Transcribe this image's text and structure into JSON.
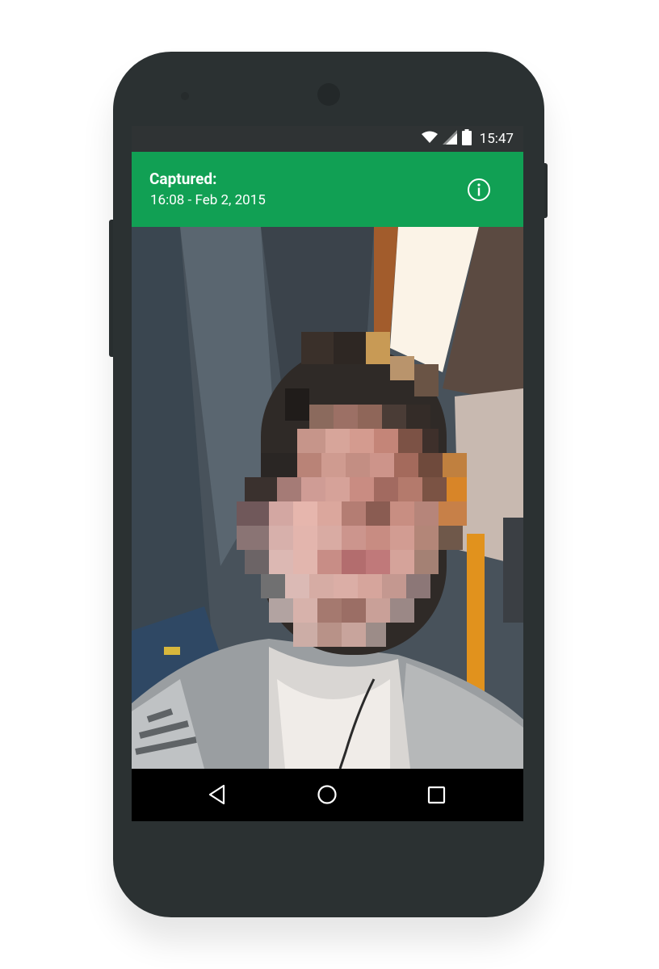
{
  "status_bar": {
    "time": "15:47",
    "icons": [
      "wifi-icon",
      "cell-signal-icon",
      "battery-icon"
    ]
  },
  "app_bar": {
    "title": "Captured:",
    "subtitle": "16:08 - Feb 2, 2015",
    "action_icon": "info-icon",
    "color": "#11a054"
  },
  "photo": {
    "description_icon": "pixelated-selfie-image"
  },
  "nav_bar": {
    "buttons": [
      "back-icon",
      "home-icon",
      "recents-icon"
    ]
  }
}
